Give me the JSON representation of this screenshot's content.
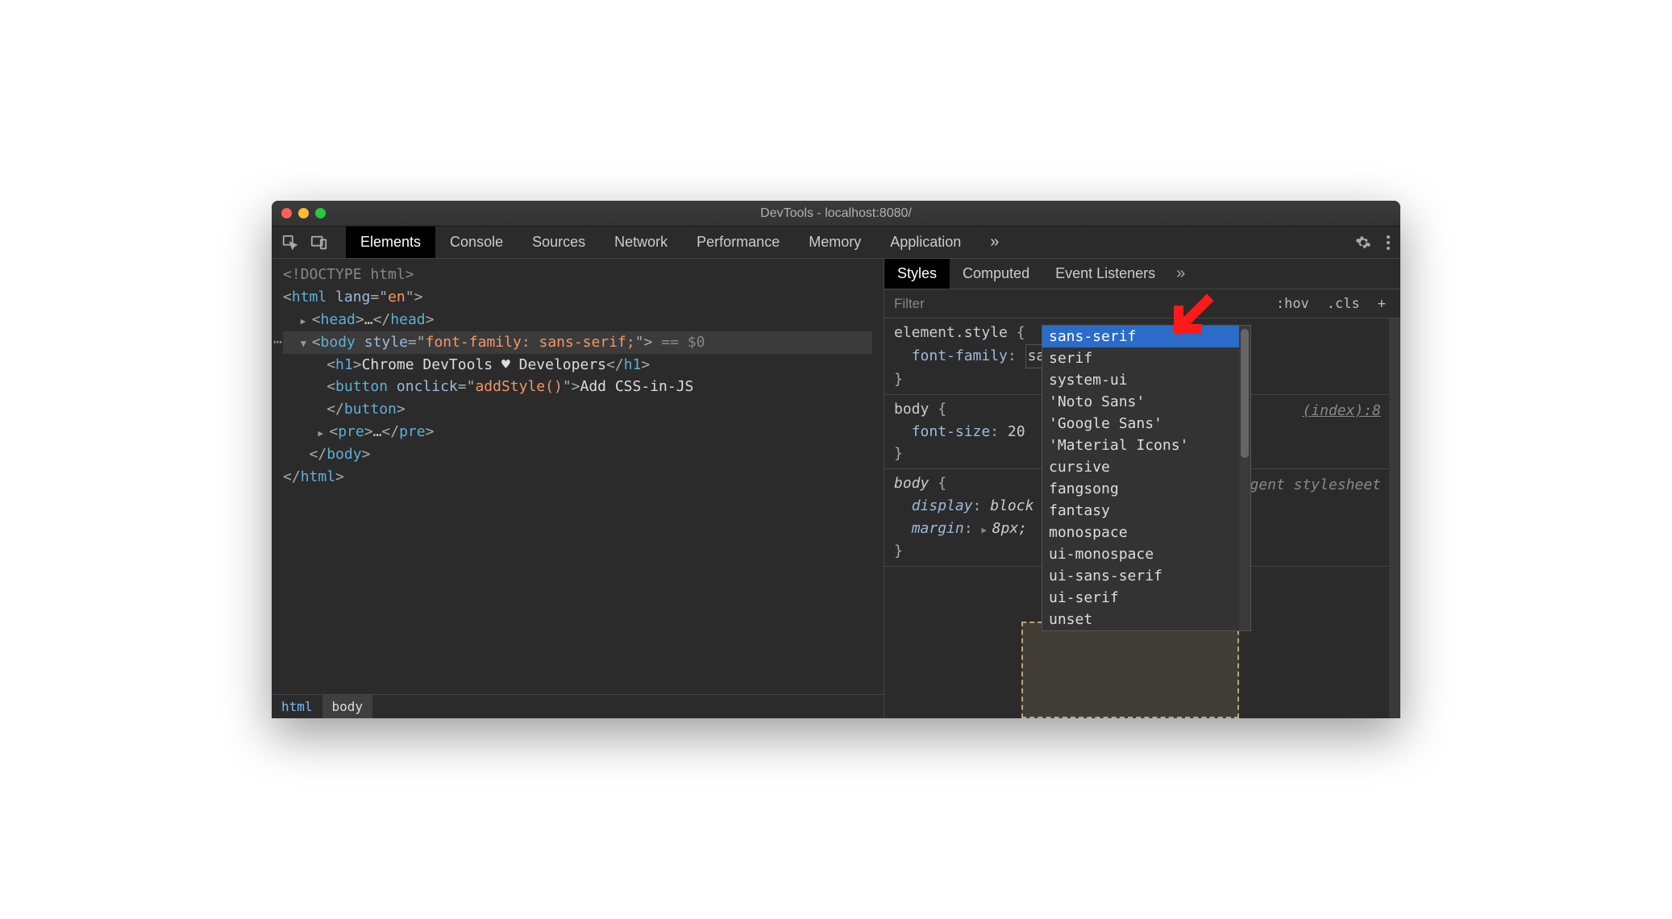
{
  "window": {
    "title": "DevTools - localhost:8080/"
  },
  "toolbar": {
    "tabs": [
      "Elements",
      "Console",
      "Sources",
      "Network",
      "Performance",
      "Memory",
      "Application"
    ],
    "active": 0
  },
  "dom": {
    "doctype": "<!DOCTYPE html>",
    "html_open": "<html lang=\"en\">",
    "head": "<head>…</head>",
    "body_open_tag": "body",
    "body_style_attr": "style",
    "body_style_val": "font-family: sans-serif;",
    "body_hint": " == $0",
    "h1_open": "<h1>",
    "h1_text": "Chrome DevTools ♥ Developers",
    "h1_close": "</h1>",
    "btn_open": "<button onclick=\"",
    "btn_onclick": "addStyle()",
    "btn_mid": "\">",
    "btn_text": "Add CSS-in-JS",
    "btn_close": "</button>",
    "pre": "<pre>…</pre>",
    "body_close": "</body>",
    "html_close": "</html>"
  },
  "breadcrumbs": [
    "html",
    "body"
  ],
  "styles": {
    "tabs": [
      "Styles",
      "Computed",
      "Event Listeners"
    ],
    "filter_placeholder": "Filter",
    "hov": ":hov",
    "cls": ".cls",
    "rules": {
      "element_style": {
        "selector": "element.style",
        "prop": "font-family",
        "value_edit": "sans-serif;"
      },
      "body_author": {
        "selector": "body",
        "src": "(index):8",
        "prop": "font-size",
        "value_prefix": "20"
      },
      "body_ua": {
        "selector": "body",
        "src": "user agent stylesheet",
        "p1": "display",
        "v1": "block",
        "p2": "margin",
        "v2": "8px;"
      }
    }
  },
  "autocomplete": {
    "selected": 0,
    "options": [
      "sans-serif",
      "serif",
      "system-ui",
      "'Noto Sans'",
      "'Google Sans'",
      "'Material Icons'",
      "cursive",
      "fangsong",
      "fantasy",
      "monospace",
      "ui-monospace",
      "ui-sans-serif",
      "ui-serif",
      "unset"
    ]
  }
}
